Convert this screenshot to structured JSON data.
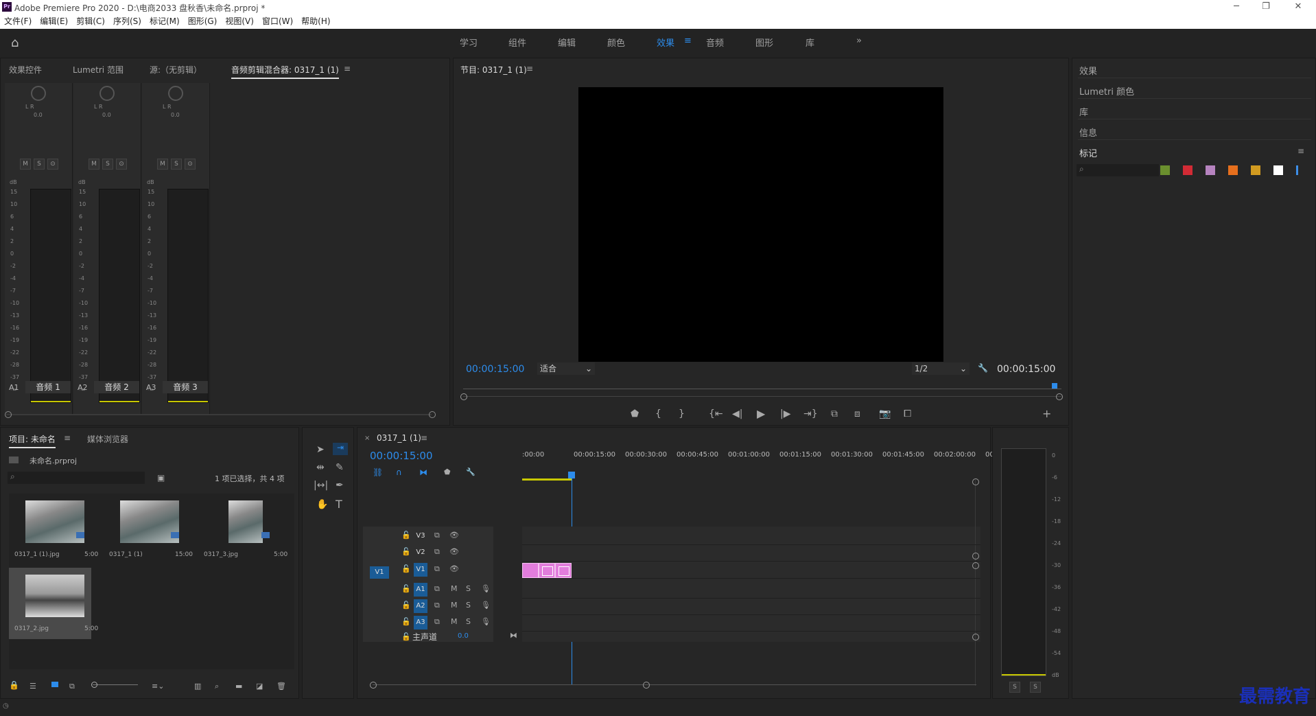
{
  "window": {
    "title": "Adobe Premiere Pro 2020 - D:\\电商2033 盘秋香\\未命名.prproj *",
    "app_icon_text": "Pr"
  },
  "menu": [
    "文件(F)",
    "编辑(E)",
    "剪辑(C)",
    "序列(S)",
    "标记(M)",
    "图形(G)",
    "视图(V)",
    "窗口(W)",
    "帮助(H)"
  ],
  "workspaces": {
    "items": [
      "学习",
      "组件",
      "编辑",
      "颜色",
      "效果",
      "音频",
      "图形",
      "库"
    ],
    "active": "效果",
    "more": "»"
  },
  "mixer_panel": {
    "tabs": [
      "效果控件",
      "Lumetri 范围",
      "源:（无剪辑）",
      "音频剪辑混合器: 0317_1 (1)"
    ],
    "active_tab": "音频剪辑混合器: 0317_1 (1)",
    "db_label": "dB",
    "lr_label": "L     R",
    "pan_value": "0.0",
    "ms_buttons": [
      "M",
      "S",
      "⊙"
    ],
    "scale": [
      "15",
      "10",
      "6",
      "4",
      "2",
      "0",
      "-2",
      "-4",
      "-7",
      "-10",
      "-13",
      "-16",
      "-19",
      "-22",
      "-28",
      "-37",
      "-∞"
    ],
    "channels": [
      {
        "id": "A1",
        "name": "音频 1"
      },
      {
        "id": "A2",
        "name": "音频 2"
      },
      {
        "id": "A3",
        "name": "音频 3"
      }
    ]
  },
  "program_monitor": {
    "title": "节目: 0317_1 (1)",
    "timecode_left": "00:00:15:00",
    "fit": "适合",
    "resolution": "1/2",
    "timecode_right": "00:00:15:00"
  },
  "right_panels": {
    "items": [
      "效果",
      "Lumetri 颜色",
      "库",
      "信息",
      "标记"
    ],
    "swatch_colors": [
      "#6a8f2e",
      "#d22b35",
      "#b683bf",
      "#e66f1d",
      "#d29b20",
      "#ffffff",
      "#3d8fe9"
    ]
  },
  "project_panel": {
    "tabs": [
      "项目: 未命名",
      "媒体浏览器"
    ],
    "file": "未命名.prproj",
    "selection": "1 项已选择，共 4 项",
    "items": [
      {
        "name": "0317_1 (1).jpg",
        "dur": "5:00"
      },
      {
        "name": "0317_1 (1)",
        "dur": "15:00"
      },
      {
        "name": "0317_3.jpg",
        "dur": "5:00"
      },
      {
        "name": "0317_2.jpg",
        "dur": "5:00"
      }
    ]
  },
  "timeline": {
    "tab": "0317_1 (1)",
    "timecode": "00:00:15:00",
    "ruler": [
      ":00:00",
      "00:00:15:00",
      "00:00:30:00",
      "00:00:45:00",
      "00:01:00:00",
      "00:01:15:00",
      "00:01:30:00",
      "00:01:45:00",
      "00:02:00:00",
      "00"
    ],
    "video_tracks": [
      "V3",
      "V2",
      "V1"
    ],
    "audio_tracks": [
      "A1",
      "A2",
      "A3"
    ],
    "source_patch": "V1",
    "master": {
      "label": "主声道",
      "value": "0.0"
    },
    "track_ms": [
      "M",
      "S"
    ]
  },
  "audio_meter": {
    "scale": [
      "0",
      "-6",
      "-12",
      "-18",
      "-24",
      "-30",
      "-36",
      "-42",
      "-48",
      "-54",
      "dB"
    ],
    "solo": [
      "S",
      "S"
    ]
  },
  "watermark": "最需教育"
}
